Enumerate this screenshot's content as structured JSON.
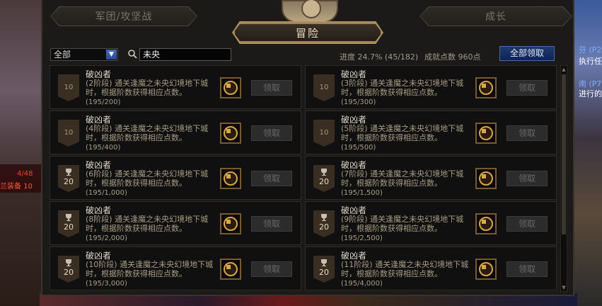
{
  "background": {
    "left_text1": "4/48",
    "left_text2": "兰装备 10",
    "right_texts": [
      "芬 (P2",
      "执行任",
      "南 (P7",
      "进行的"
    ]
  },
  "tabs": {
    "left": "军团/攻坚战",
    "right": "成长",
    "active": "冒险"
  },
  "filter": {
    "selected": "全部",
    "arrow": "▼"
  },
  "search": {
    "value": "未央"
  },
  "progress": "进度 24.7% (45/182)",
  "points": "成就点数 960点",
  "claim_all_label": "全部领取",
  "claim_label": "领取",
  "scrollbar": {
    "up": "▲",
    "down": "▼"
  },
  "achievements": [
    {
      "title": "破凶者",
      "desc": "(2阶段) 通关逢魔之未央幻境地下城时，根据阶数获得相应点数。",
      "progress": "(195/200)",
      "badge": "10",
      "trophy": false
    },
    {
      "title": "破凶者",
      "desc": "(3阶段) 通关逢魔之未央幻境地下城时，根据阶数获得相应点数。",
      "progress": "(195/300)",
      "badge": "10",
      "trophy": false
    },
    {
      "title": "破凶者",
      "desc": "(4阶段) 通关逢魔之未央幻境地下城时，根据阶数获得相应点数。",
      "progress": "(195/400)",
      "badge": "10",
      "trophy": false
    },
    {
      "title": "破凶者",
      "desc": "(5阶段) 通关逢魔之未央幻境地下城时，根据阶数获得相应点数。",
      "progress": "(195/500)",
      "badge": "10",
      "trophy": false
    },
    {
      "title": "破凶者",
      "desc": "(6阶段) 通关逢魔之未央幻境地下城时，根据阶数获得相应点数。",
      "progress": "(195/1,000)",
      "badge": "20",
      "trophy": true
    },
    {
      "title": "破凶者",
      "desc": "(7阶段) 通关逢魔之未央幻境地下城时，根据阶数获得相应点数。",
      "progress": "(195/1,500)",
      "badge": "20",
      "trophy": true
    },
    {
      "title": "破凶者",
      "desc": "(8阶段) 通关逢魔之未央幻境地下城时，根据阶数获得相应点数。",
      "progress": "(195/2,000)",
      "badge": "20",
      "trophy": true
    },
    {
      "title": "破凶者",
      "desc": "(9阶段) 通关逢魔之未央幻境地下城时，根据阶数获得相应点数。",
      "progress": "(195/2,500)",
      "badge": "20",
      "trophy": true
    },
    {
      "title": "破凶者",
      "desc": "(10阶段) 通关逢魔之未央幻境地下城时，根据阶数获得相应点数。",
      "progress": "(195/3,000)",
      "badge": "20",
      "trophy": true
    },
    {
      "title": "破凶者",
      "desc": "(11阶段) 通关逢魔之未央幻境地下城时，根据阶数获得相应点数。",
      "progress": "(195/4,000)",
      "badge": "20",
      "trophy": true
    }
  ],
  "colors": {
    "accent_gold": "#b09060",
    "claim_all_bg": "#1e3a6e",
    "reward_gold": "#d8a848"
  }
}
